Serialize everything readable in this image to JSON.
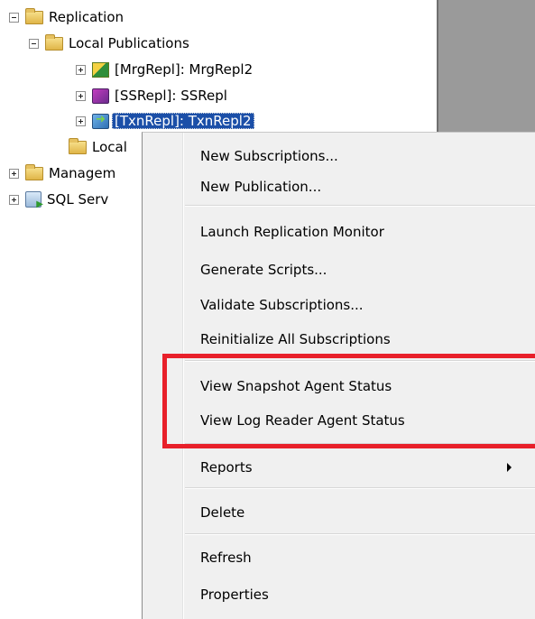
{
  "tree": {
    "replication": "Replication",
    "local_publications": "Local Publications",
    "pub_merge": "[MrgRepl]: MrgRepl2",
    "pub_snapshot": "[SSRepl]: SSRepl",
    "pub_txn": "[TxnRepl]: TxnRepl2",
    "local_subscriptions": "Local",
    "management": "Managem",
    "sql_server_agent": "SQL Serv"
  },
  "context_menu": {
    "items": [
      {
        "label": "New Subscriptions..."
      },
      {
        "label": "New Publication..."
      },
      {
        "label": "Launch Replication Monitor"
      },
      {
        "label": "Generate Scripts..."
      },
      {
        "label": "Validate Subscriptions..."
      },
      {
        "label": "Reinitialize All Subscriptions"
      },
      {
        "label": "View Snapshot Agent Status"
      },
      {
        "label": "View Log Reader Agent Status"
      },
      {
        "label": "Reports"
      },
      {
        "label": "Delete"
      },
      {
        "label": "Refresh"
      },
      {
        "label": "Properties"
      }
    ]
  },
  "annotation": {
    "highlight_color": "#e8202a"
  }
}
